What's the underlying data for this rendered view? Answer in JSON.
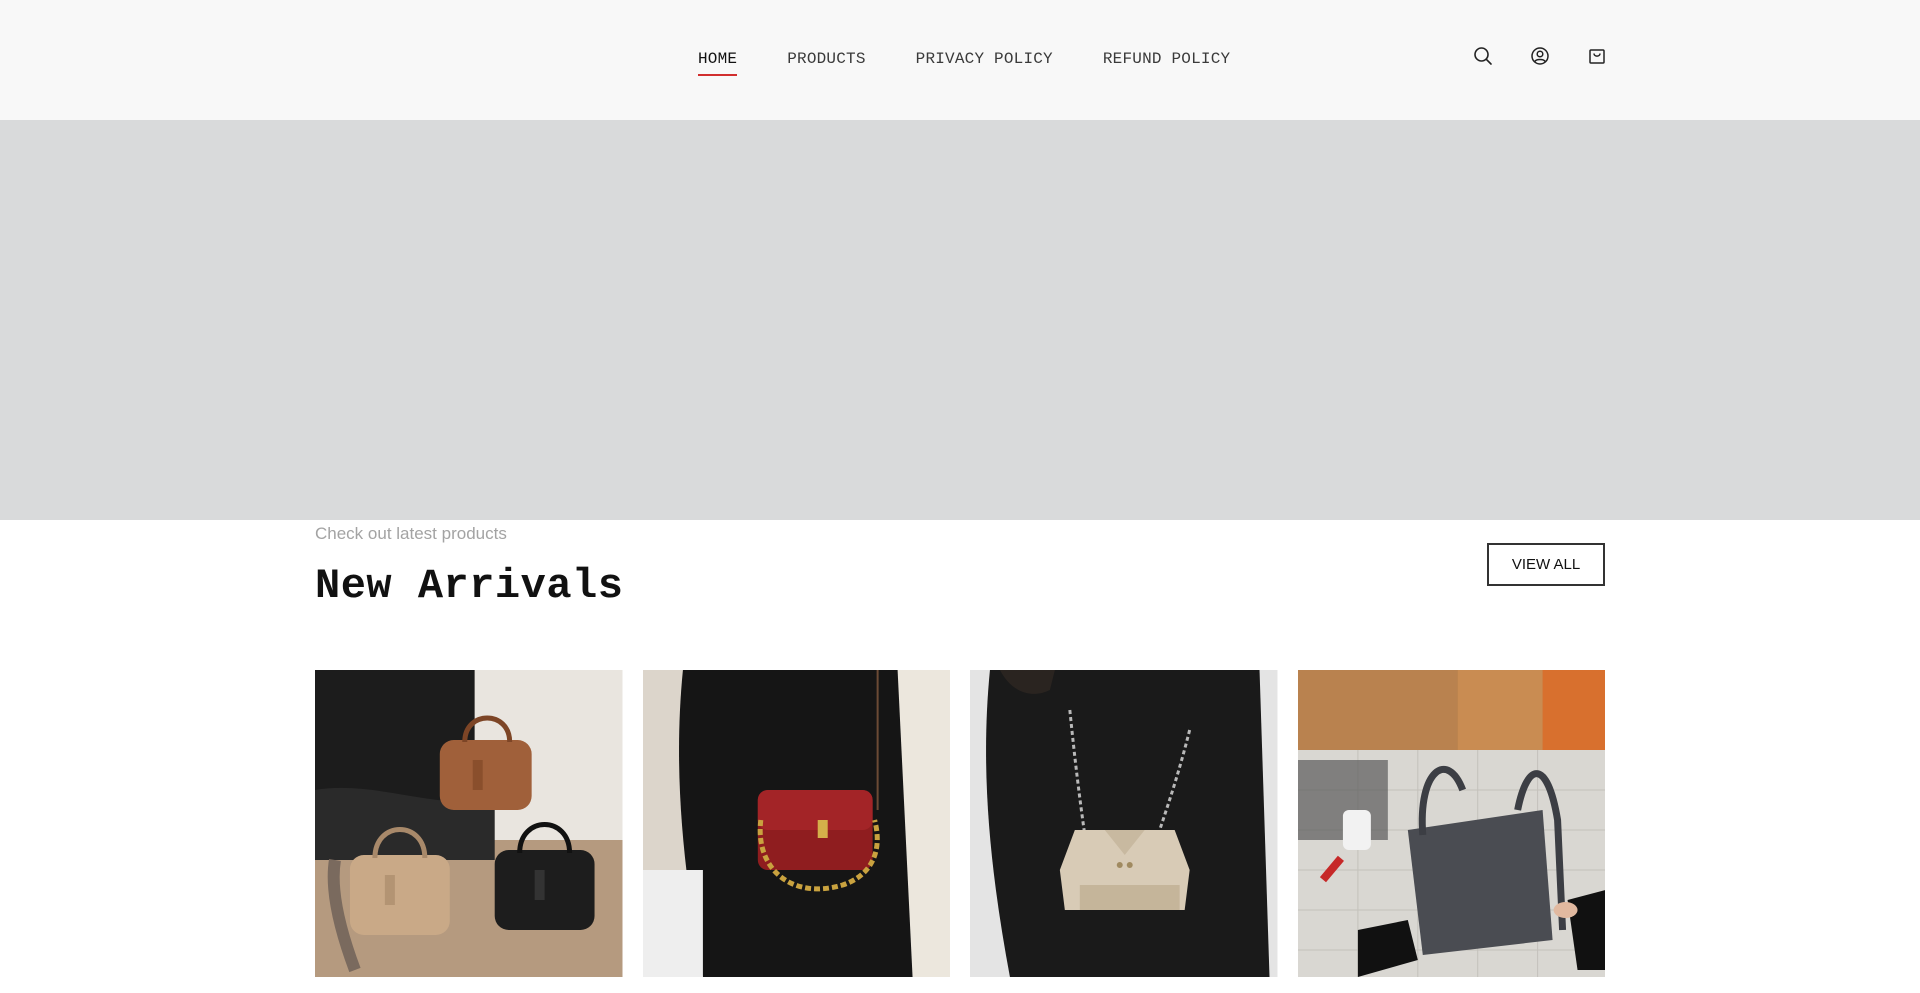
{
  "nav": {
    "items": [
      {
        "label": "HOME",
        "active": true
      },
      {
        "label": "PRODUCTS",
        "active": false
      },
      {
        "label": "PRIVACY POLICY",
        "active": false
      },
      {
        "label": "REFUND POLICY",
        "active": false
      }
    ],
    "active_underline_color": "#d12e2e"
  },
  "header_icons": [
    "search-icon",
    "account-icon",
    "cart-icon"
  ],
  "hero": {
    "background": "#d9dadb"
  },
  "section": {
    "eyebrow": "Check out latest products",
    "title": "New Arrivals",
    "view_all_label": "VIEW ALL"
  },
  "products": [
    {
      "image": "three-leather-handbags-tan-brown-black"
    },
    {
      "image": "red-crossbody-bag-gold-chain"
    },
    {
      "image": "beige-jacket-shaped-mini-bag-chain-strap"
    },
    {
      "image": "grey-leather-tote-bag-on-workbench"
    }
  ]
}
